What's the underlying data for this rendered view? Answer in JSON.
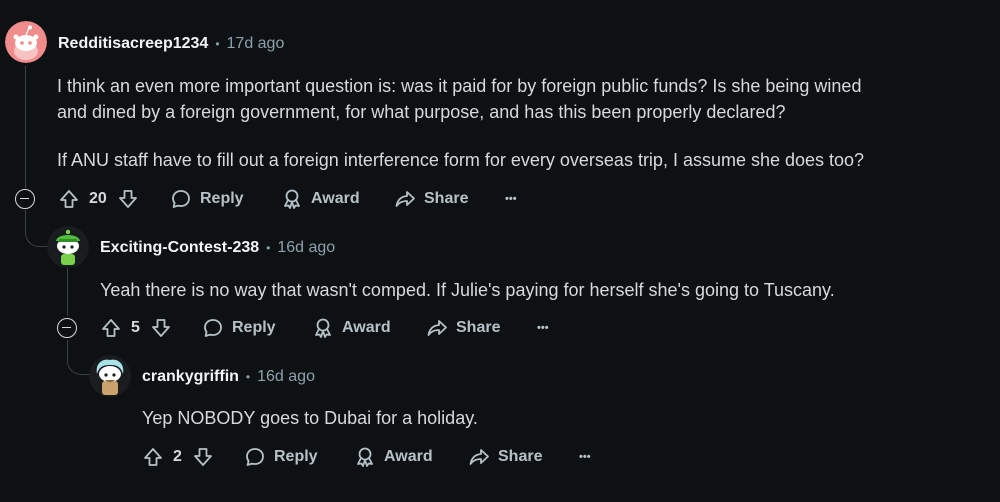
{
  "comments": [
    {
      "author": "Redditisacreep1234",
      "separator": "•",
      "age": "17d ago",
      "paragraphs": [
        "I think an even more important question is: was it paid for by foreign public funds? Is she being wined",
        "and dined by a foreign government, for what purpose, and has this been properly declared?",
        "If ANU staff have to fill out a foreign interference form for every overseas trip, I assume she does too?"
      ],
      "votes": "20",
      "reply_label": "Reply",
      "award_label": "Award",
      "share_label": "Share",
      "more_label": "•••",
      "avatar_color": "#f08c8c"
    },
    {
      "author": "Exciting-Contest-238",
      "separator": "•",
      "age": "16d ago",
      "paragraphs": [
        "Yeah there is no way that wasn't comped. If Julie's paying for herself she's going to Tuscany."
      ],
      "votes": "5",
      "reply_label": "Reply",
      "award_label": "Award",
      "share_label": "Share",
      "more_label": "•••",
      "avatar_color": "#4fbf3c"
    },
    {
      "author": "crankygriffin",
      "separator": "•",
      "age": "16d ago",
      "paragraphs": [
        "Yep NOBODY goes to Dubai for a holiday."
      ],
      "votes": "2",
      "reply_label": "Reply",
      "award_label": "Award",
      "share_label": "Share",
      "more_label": "•••",
      "avatar_color": "#a7e3e8"
    }
  ],
  "colors": {
    "background": "#0e1113",
    "text": "#d7dadc",
    "meta": "#8ba2ad",
    "thread_line": "#3a4144"
  }
}
